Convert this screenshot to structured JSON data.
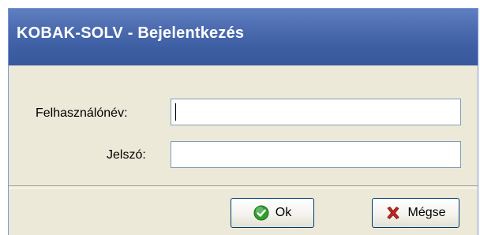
{
  "window": {
    "title": "KOBAK-SOLV - Bejelentkezés"
  },
  "form": {
    "username_label": "Felhasználónév:",
    "username_value": "",
    "password_label": "Jelszó:",
    "password_value": ""
  },
  "buttons": {
    "ok_label": "Ok",
    "cancel_label": "Mégse",
    "ok_icon": "check-circle-icon",
    "cancel_icon": "red-x-icon"
  },
  "colors": {
    "titlebar": "#3d5ea3",
    "dialog_bg": "#ece9d8",
    "ok_icon": "#2e9f2e",
    "cancel_icon": "#c0281e"
  }
}
